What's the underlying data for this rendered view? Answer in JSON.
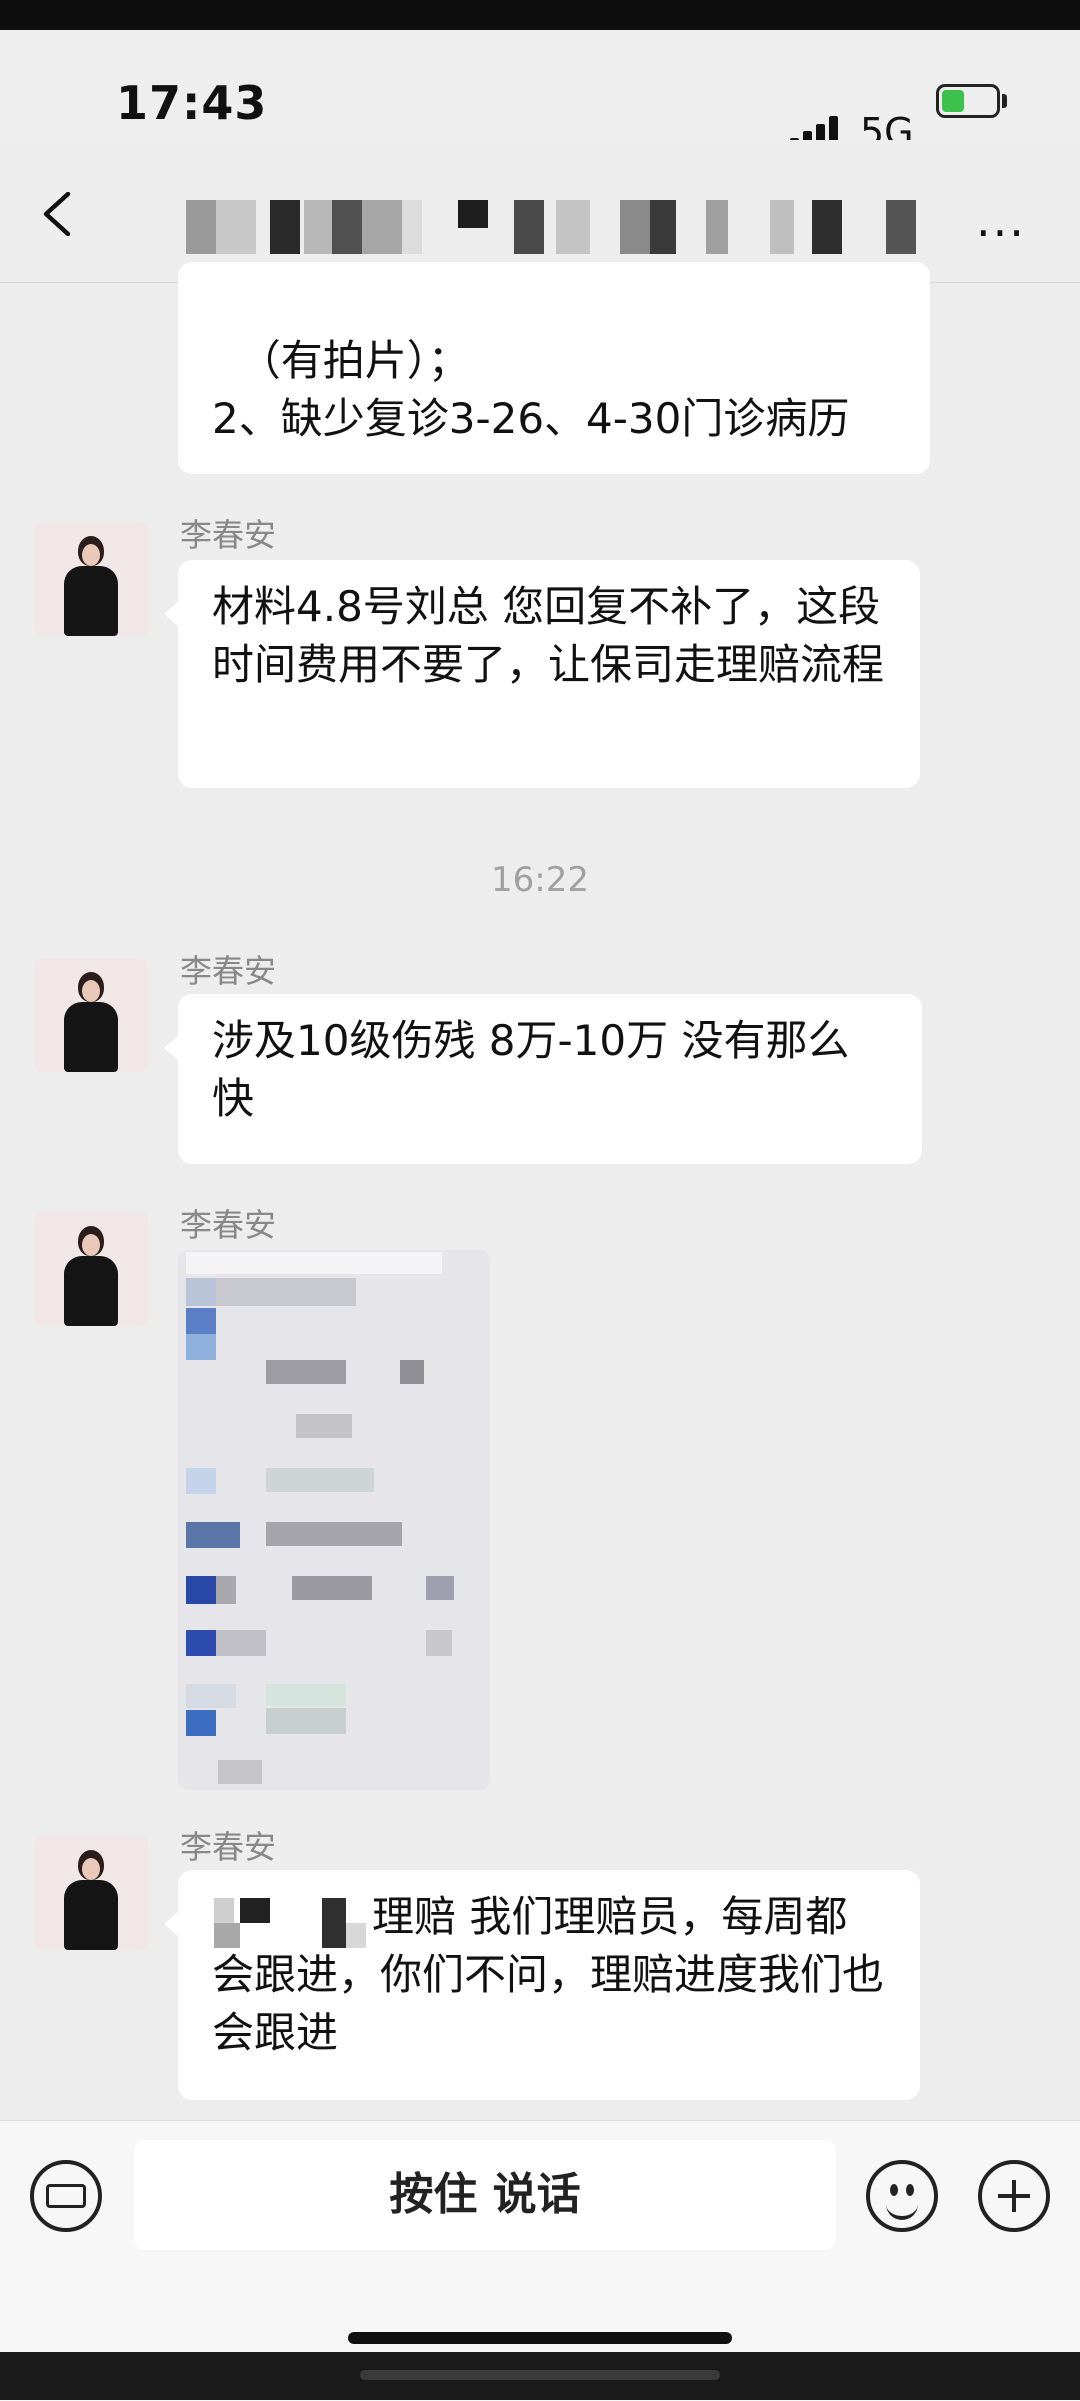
{
  "status_bar": {
    "time": "17:43",
    "network": "5G"
  },
  "nav": {
    "back_label": "back",
    "more_label": "···"
  },
  "messages": [
    {
      "text": "（有拍片）；\n2、缺少复诊3-26、4-30门诊病历"
    },
    {
      "sender": "李春安",
      "text": "材料4.8号刘总 您回复不补了，这段时间费用不要了，让保司走理赔流程"
    },
    {
      "sender": "李春安",
      "text": "涉及10级伤残 8万-10万 没有那么快"
    },
    {
      "sender": "李春安"
    },
    {
      "sender": "李春安",
      "text": "理赔 我们理赔员，每周都会跟进，你们不问，理赔进度我们也会跟进"
    }
  ],
  "timestamp": "16:22",
  "input": {
    "voice_label": "按住 说话"
  },
  "colors": {
    "background": "#ededed",
    "bubble": "#ffffff",
    "input_bar": "#f7f7f7"
  }
}
